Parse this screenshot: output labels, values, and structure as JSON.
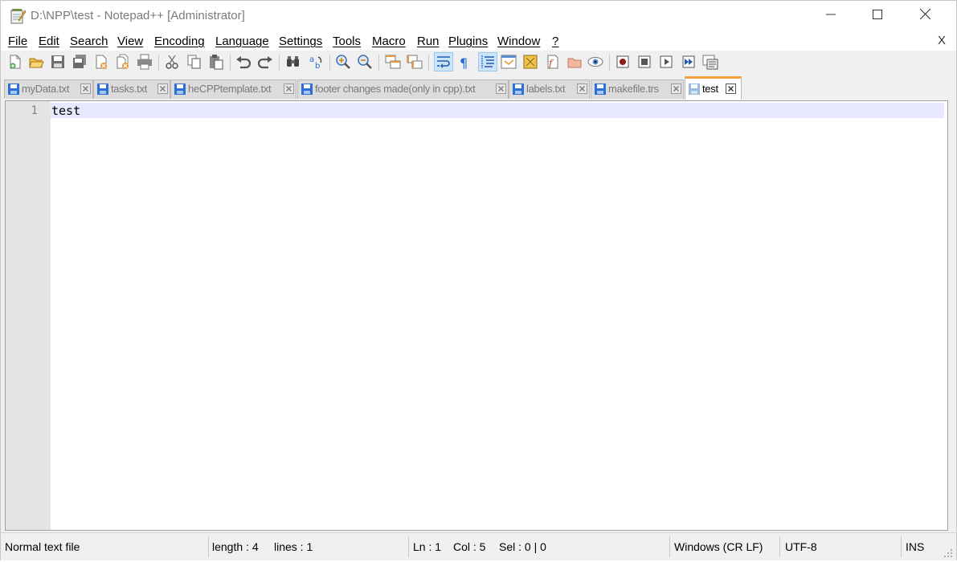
{
  "window": {
    "title": "D:\\NPP\\test - Notepad++ [Administrator]",
    "controls": [
      "minimize-icon",
      "maximize-icon",
      "close-icon"
    ]
  },
  "menu": {
    "items": [
      "File",
      "Edit",
      "Search",
      "View",
      "Encoding",
      "Language",
      "Settings",
      "Tools",
      "Macro",
      "Run",
      "Plugins",
      "Window",
      "?"
    ],
    "close_label": "X"
  },
  "toolbar": {
    "icons": [
      "new-file-icon",
      "open-file-icon",
      "save-icon",
      "save-all-icon",
      "close-icon",
      "close-all-icon",
      "print-icon",
      "cut-icon",
      "copy-icon",
      "paste-icon",
      "undo-icon",
      "redo-icon",
      "find-icon",
      "replace-icon",
      "zoom-in-icon",
      "zoom-out-icon",
      "sync-vertical-icon",
      "sync-horizontal-icon",
      "word-wrap-icon",
      "show-all-chars-icon",
      "indent-guide-icon",
      "document-map-icon",
      "user-defined-language-icon",
      "function-list-icon",
      "folder-as-workspace-icon",
      "monitoring-icon",
      "record-macro-icon",
      "stop-recording-icon",
      "playback-macro-icon",
      "run-macro-multiple-icon",
      "save-macro-icon"
    ]
  },
  "tabs": [
    {
      "label": "myData.txt",
      "active": false
    },
    {
      "label": "tasks.txt",
      "active": false
    },
    {
      "label": "heCPPtemplate.txt",
      "active": false
    },
    {
      "label": "footer changes made(only in cpp).txt",
      "active": false
    },
    {
      "label": "labels.txt",
      "active": false
    },
    {
      "label": "makefile.trs",
      "active": false
    },
    {
      "label": "test",
      "active": true
    }
  ],
  "editor": {
    "line_numbers": [
      "1"
    ],
    "lines": [
      "test"
    ]
  },
  "status": {
    "file_type": "Normal text file",
    "length": "length : 4",
    "lines": "lines : 1",
    "ln": "Ln : 1",
    "col": "Col : 5",
    "sel": "Sel : 0 | 0",
    "eol": "Windows (CR LF)",
    "encoding": "UTF-8",
    "mode": "INS"
  },
  "colors": {
    "active_tab_accent": "#f5a23a",
    "current_line": "#e8e8ff",
    "gutter": "#e4e4e4",
    "save_icon_blue": "#2d6fd6"
  }
}
